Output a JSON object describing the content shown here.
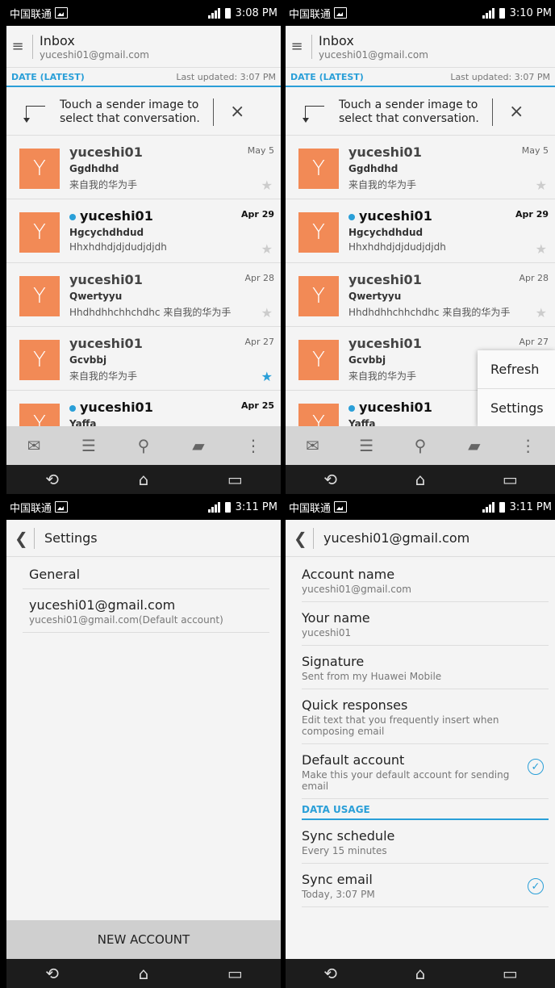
{
  "status": {
    "carrier": "中国联通",
    "times": [
      "3:08 PM",
      "3:10 PM",
      "3:11 PM",
      "3:11 PM"
    ]
  },
  "inbox": {
    "title": "Inbox",
    "account": "yuceshi01@gmail.com",
    "sort_label": "DATE (LATEST)",
    "updated": "Last updated: 3:07 PM",
    "tip": "Touch a sender image to select that conversation.",
    "close_icon": "×",
    "messages": [
      {
        "avatar": "Y",
        "sender": "yuceshi01",
        "subject": "Ggdhdhd",
        "snippet": "来自我的华为手",
        "date": "May 5",
        "unread": false,
        "starred": false
      },
      {
        "avatar": "Y",
        "sender": "yuceshi01",
        "subject": "Hgcychdhdud",
        "snippet": "Hhxhdhdjdjdudjdjdh",
        "date": "Apr 29",
        "unread": true,
        "starred": false
      },
      {
        "avatar": "Y",
        "sender": "yuceshi01",
        "subject": "Qwertyyu",
        "snippet": "Hhdhdhhchhchdhc 来自我的华为手",
        "date": "Apr 28",
        "unread": false,
        "starred": false
      },
      {
        "avatar": "Y",
        "sender": "yuceshi01",
        "subject": "Gcvbbj",
        "snippet": "来自我的华为手",
        "date": "Apr 27",
        "unread": false,
        "starred": true
      },
      {
        "avatar": "Y",
        "sender": "yuceshi01",
        "subject": "Yaffa",
        "snippet": "",
        "date": "Apr 25",
        "unread": true,
        "starred": false
      }
    ]
  },
  "overflow_menu": {
    "refresh": "Refresh",
    "settings": "Settings"
  },
  "settings": {
    "title": "Settings",
    "general": "General",
    "account_email": "yuceshi01@gmail.com",
    "account_sub": "yuceshi01@gmail.com(Default account)",
    "new_account": "NEW ACCOUNT"
  },
  "account_settings": {
    "title": "yuceshi01@gmail.com",
    "items": [
      {
        "title": "Account name",
        "sub": "yuceshi01@gmail.com"
      },
      {
        "title": "Your name",
        "sub": "yuceshi01"
      },
      {
        "title": "Signature",
        "sub": "Sent from my Huawei Mobile"
      },
      {
        "title": "Quick responses",
        "sub": "Edit text that you frequently insert when composing email"
      },
      {
        "title": "Default account",
        "sub": "Make this your default account for sending email"
      }
    ],
    "section": "DATA USAGE",
    "items2": [
      {
        "title": "Sync schedule",
        "sub": "Every 15 minutes"
      },
      {
        "title": "Sync email",
        "sub": "Today, 3:07 PM"
      }
    ]
  },
  "icons": {
    "menu": "≡",
    "back": "❮",
    "star": "★",
    "check": "✓",
    "nav_back": "⟲",
    "nav_home": "⌂",
    "nav_recent": "▭"
  }
}
